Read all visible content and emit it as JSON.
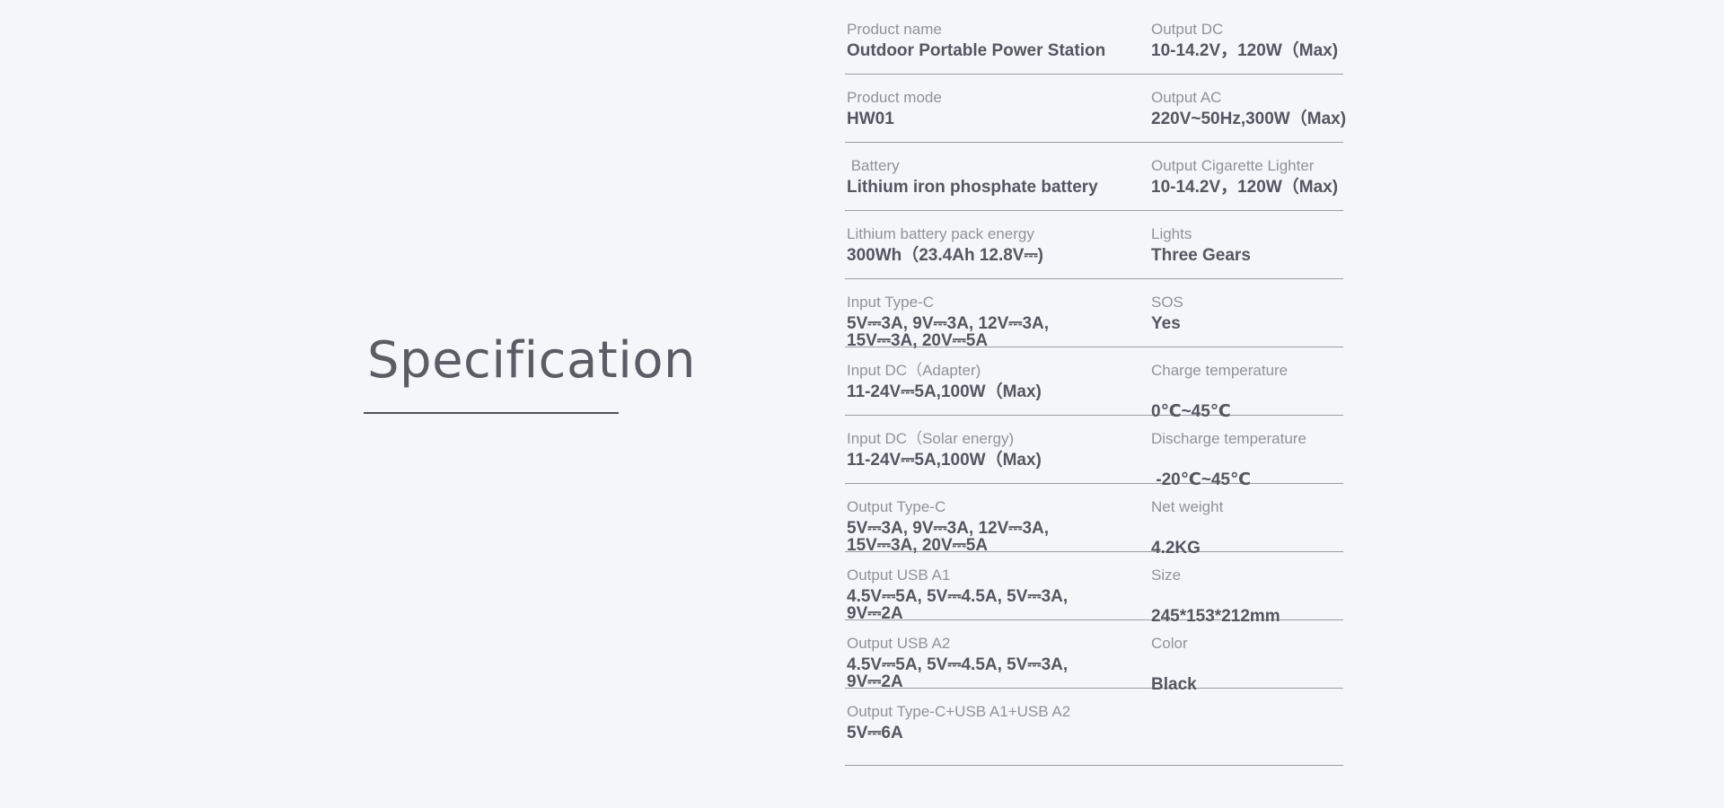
{
  "heading": "Specification",
  "rows": [
    {
      "left": {
        "label": "Product name",
        "value": "Outdoor Portable Power Station"
      },
      "right": {
        "label": "Output DC",
        "value": "10-14.2V，120W（Max)"
      }
    },
    {
      "left": {
        "label": "Product mode",
        "value": "HW01"
      },
      "right": {
        "label": "Output AC",
        "value": "220V~50Hz,300W（Max)"
      }
    },
    {
      "left": {
        "label": " Battery",
        "value": "Lithium iron phosphate battery"
      },
      "right": {
        "label": "Output Cigarette Lighter",
        "value": "10-14.2V，120W（Max)"
      }
    },
    {
      "left": {
        "label": "Lithium battery pack energy",
        "value": "300Wh（23.4Ah 12.8V⎓)"
      },
      "right": {
        "label": "Lights",
        "value": "Three Gears"
      }
    },
    {
      "left": {
        "label": "Input Type-C",
        "value_line1": "5V⎓3A, 9V⎓3A, 12V⎓3A,",
        "value_line2": "15V⎓3A, 20V⎓5A"
      },
      "right": {
        "label": "SOS",
        "value": "Yes"
      }
    },
    {
      "left": {
        "label": "Input DC（Adapter)",
        "value": "11-24V⎓5A,100W（Max)"
      },
      "right": {
        "label": "Charge temperature",
        "value": "0℃~45℃"
      }
    },
    {
      "left": {
        "label": "Input DC（Solar energy)",
        "value": "11-24V⎓5A,100W（Max)"
      },
      "right": {
        "label": "Discharge temperature",
        "value": " -20℃~45℃"
      }
    },
    {
      "left": {
        "label": "Output Type-C",
        "value_line1": "5V⎓3A, 9V⎓3A, 12V⎓3A,",
        "value_line2": "15V⎓3A, 20V⎓5A"
      },
      "right": {
        "label": "Net weight",
        "value": "4.2KG"
      }
    },
    {
      "left": {
        "label": "Output USB A1",
        "value_line1": "4.5V⎓5A, 5V⎓4.5A, 5V⎓3A,",
        "value_line2": "9V⎓2A"
      },
      "right": {
        "label": "Size",
        "value": "245*153*212mm"
      }
    },
    {
      "left": {
        "label": "Output USB A2",
        "value_line1": "4.5V⎓5A, 5V⎓4.5A, 5V⎓3A,",
        "value_line2": "9V⎓2A"
      },
      "right": {
        "label": "Color",
        "value": "Black"
      }
    },
    {
      "left": {
        "label": "Output Type-C+USB A1+USB A2",
        "value": "5V⎓6A"
      }
    }
  ]
}
